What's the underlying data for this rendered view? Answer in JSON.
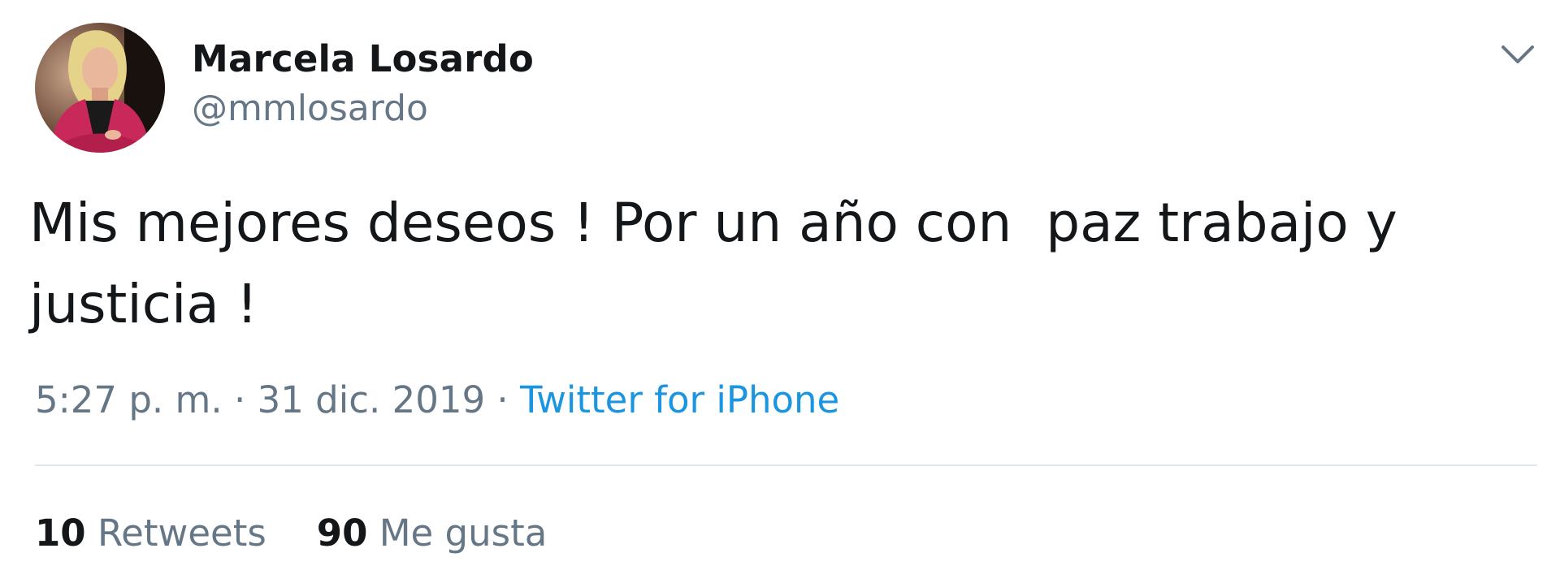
{
  "author": {
    "name": "Marcela Losardo",
    "handle": "@mmlosardo",
    "avatar_icon": "profile-photo"
  },
  "menu_icon": "chevron-down-icon",
  "tweet": {
    "text": "Mis mejores deseos ! Por un año con  paz trabajo y\njusticia !"
  },
  "meta": {
    "time": "5:27 p. m.",
    "separator1": " · ",
    "date": "31 dic. 2019",
    "separator2": " · ",
    "source": "Twitter for iPhone"
  },
  "stats": {
    "retweets_count": "10",
    "retweets_label": "Retweets",
    "likes_count": "90",
    "likes_label": "Me gusta"
  },
  "colors": {
    "text": "#14171a",
    "secondary": "#657786",
    "link": "#1b95e0",
    "divider": "#e1e8ed"
  }
}
